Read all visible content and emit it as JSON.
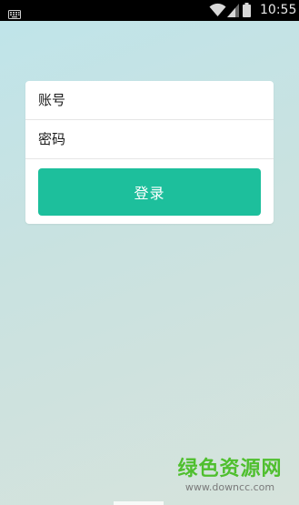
{
  "status_bar": {
    "time": "10:55"
  },
  "login_form": {
    "account_placeholder": "账号",
    "password_placeholder": "密码",
    "login_label": "登录"
  },
  "watermark": {
    "title": "绿色资源网",
    "url": "www.downcc.com"
  },
  "colors": {
    "accent": "#1dbf9c",
    "background_top": "#bfe4ea",
    "background_bottom": "#d6e3dc",
    "watermark_green": "#4fbf2e"
  }
}
